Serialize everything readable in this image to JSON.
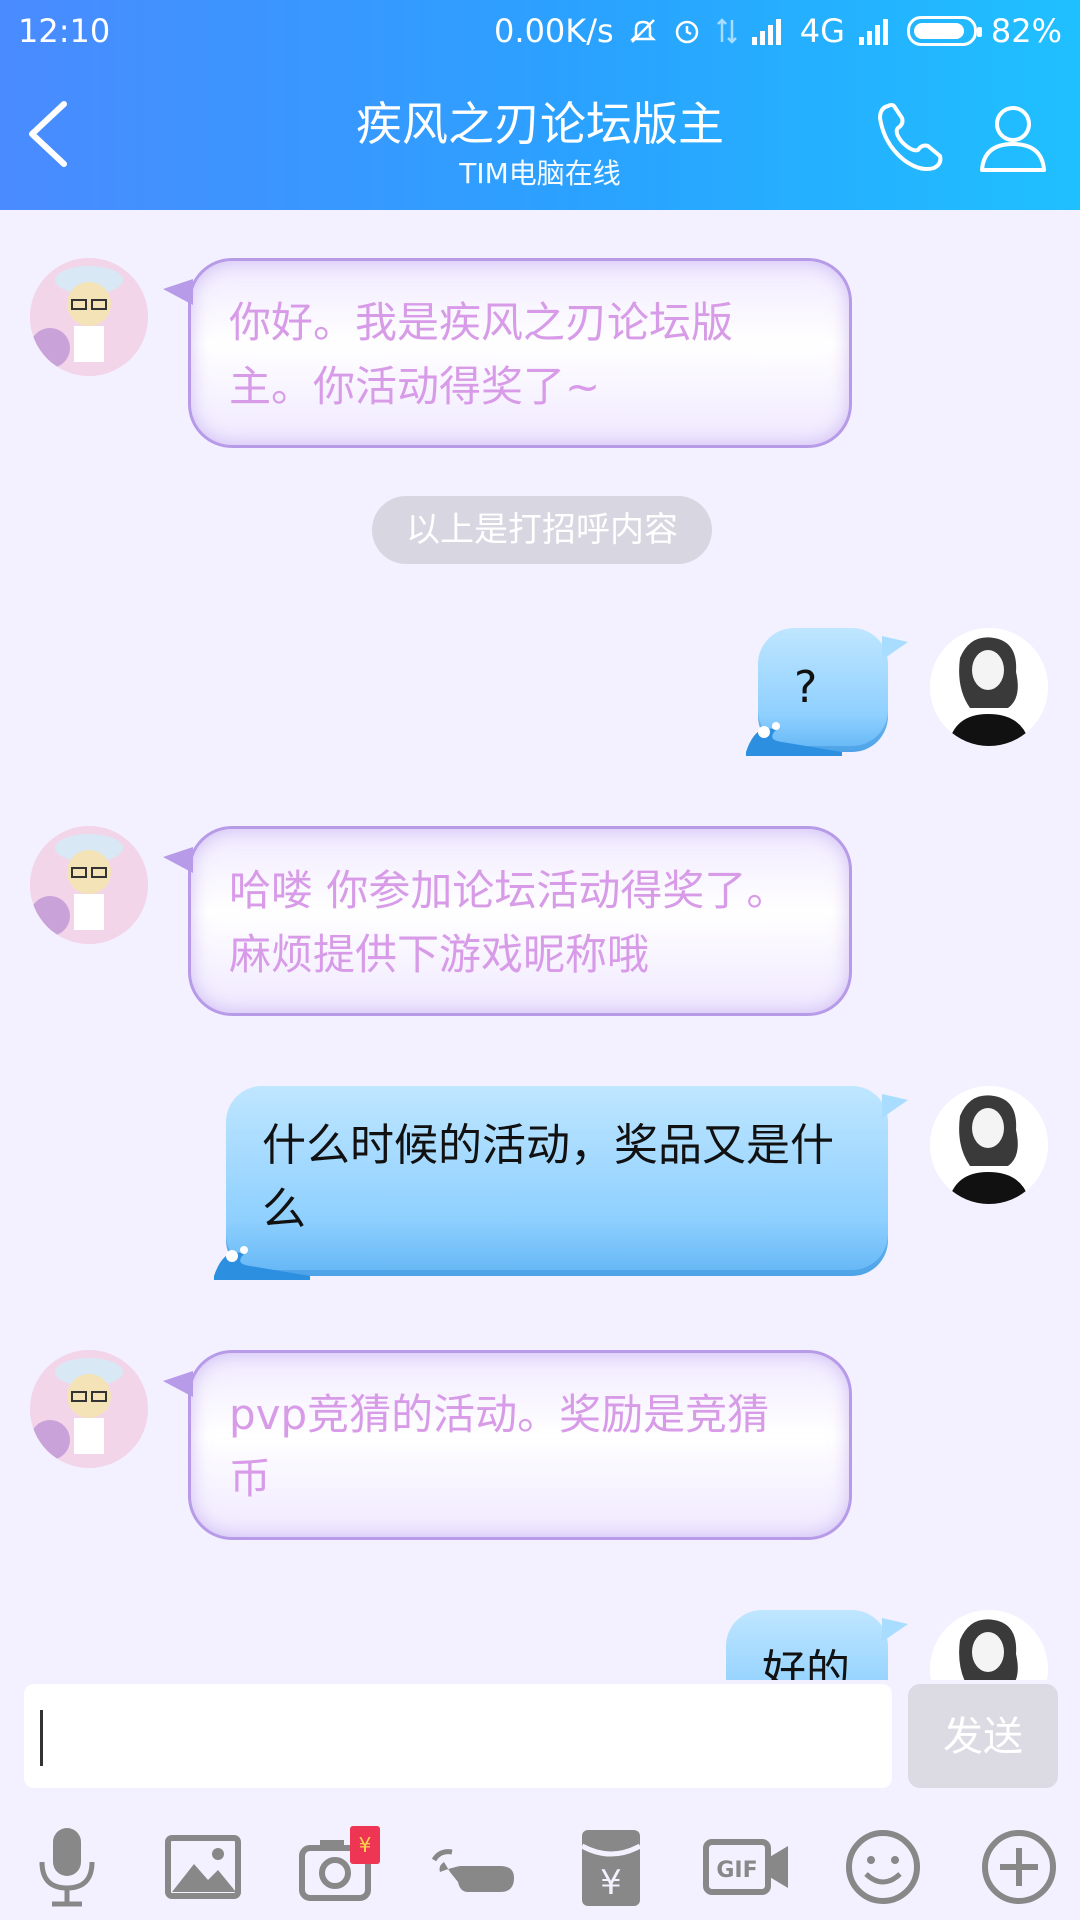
{
  "status_bar": {
    "time": "12:10",
    "net_speed": "0.00K/s",
    "network": "4G",
    "battery": "82%"
  },
  "header": {
    "title": "疾风之刃论坛版主",
    "subtitle": "TIM电脑在线"
  },
  "messages": [
    {
      "side": "left",
      "text": "你好。我是疾风之刃论坛版主。你活动得奖了~"
    },
    {
      "type": "system",
      "text": "以上是打招呼内容"
    },
    {
      "side": "right",
      "text": "?"
    },
    {
      "side": "left",
      "text": "哈喽 你参加论坛活动得奖了。麻烦提供下游戏昵称哦"
    },
    {
      "side": "right",
      "text": "什么时候的活动，奖品又是什么"
    },
    {
      "side": "left",
      "text": "pvp竞猜的活动。奖励是竞猜币"
    },
    {
      "side": "right",
      "text": "好的"
    }
  ],
  "input": {
    "value": "",
    "send_label": "发送"
  },
  "toolbar": {
    "items": [
      "mic-icon",
      "image-icon",
      "camera-icon",
      "poke-icon",
      "red-envelope-icon",
      "gif-icon",
      "emoji-icon",
      "plus-icon"
    ],
    "gif_label": "GIF"
  },
  "colors": {
    "header_start": "#4a8bff",
    "header_end": "#1fc0ff",
    "left_text": "#d89be8",
    "right_bubble": "#8fd0ff"
  }
}
